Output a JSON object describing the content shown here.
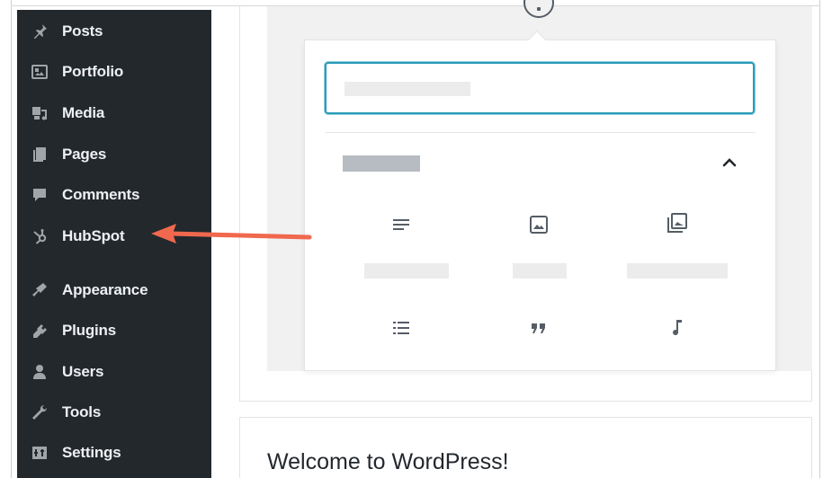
{
  "sidebar": {
    "items": [
      {
        "label": "Posts",
        "icon": "pin-icon"
      },
      {
        "label": "Portfolio",
        "icon": "portfolio-icon"
      },
      {
        "label": "Media",
        "icon": "media-icon"
      },
      {
        "label": "Pages",
        "icon": "pages-icon"
      },
      {
        "label": "Comments",
        "icon": "comments-icon"
      },
      {
        "label": "HubSpot",
        "icon": "hubspot-icon"
      },
      {
        "label": "Appearance",
        "icon": "appearance-icon"
      },
      {
        "label": "Plugins",
        "icon": "plugins-icon"
      },
      {
        "label": "Users",
        "icon": "users-icon"
      },
      {
        "label": "Tools",
        "icon": "tools-icon"
      },
      {
        "label": "Settings",
        "icon": "settings-icon"
      }
    ]
  },
  "inserter": {
    "blocks": [
      {
        "icon": "paragraph-icon"
      },
      {
        "icon": "image-icon"
      },
      {
        "icon": "gallery-icon"
      },
      {
        "icon": "list-icon"
      },
      {
        "icon": "quote-icon"
      },
      {
        "icon": "audio-icon"
      }
    ]
  },
  "welcome": {
    "title": "Welcome to WordPress!"
  },
  "colors": {
    "sidebar_bg": "#23282d",
    "sidebar_text": "#eef0f2",
    "search_focus": "#2a9bb8",
    "annotation_arrow": "#f0684d"
  }
}
